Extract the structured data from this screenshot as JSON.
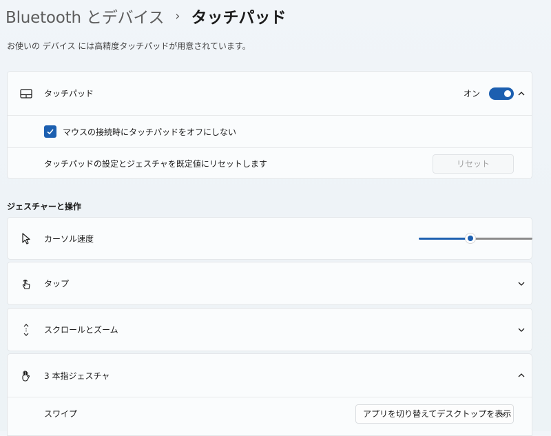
{
  "breadcrumb": {
    "parent": "Bluetooth とデバイス",
    "separator": "›",
    "current": "タッチパッド"
  },
  "subtitle": "お使いの デバイス には高精度タッチパッドが用意されています。",
  "touchpad": {
    "title": "タッチパッド",
    "toggle_label": "オン",
    "toggle_on": true,
    "checkbox_label": "マウスの接続時にタッチパッドをオフにしない",
    "checkbox_checked": true,
    "reset_text": "タッチパッドの設定とジェスチャを既定値にリセットします",
    "reset_button": "リセット"
  },
  "gestures": {
    "section_title": "ジェスチャーと操作",
    "cursor_speed": {
      "label": "カーソル速度",
      "value_fraction": 0.45
    },
    "tap": {
      "label": "タップ"
    },
    "scroll_zoom": {
      "label": "スクロールとズーム"
    },
    "three_finger": {
      "label": "3 本指ジェスチャ",
      "swipe_label": "スワイプ",
      "swipe_value": "アプリを切り替えてデスクトップを表示"
    }
  },
  "icons": {
    "touchpad": "touchpad-icon",
    "cursor": "cursor-arrow-icon",
    "tap": "tap-hand-icon",
    "scroll": "scroll-arrows-icon",
    "three_finger": "hand-icon",
    "chevron_up": "chevron-up-icon",
    "chevron_down": "chevron-down-icon",
    "check": "check-icon"
  },
  "colors": {
    "accent": "#1c5fb0"
  }
}
